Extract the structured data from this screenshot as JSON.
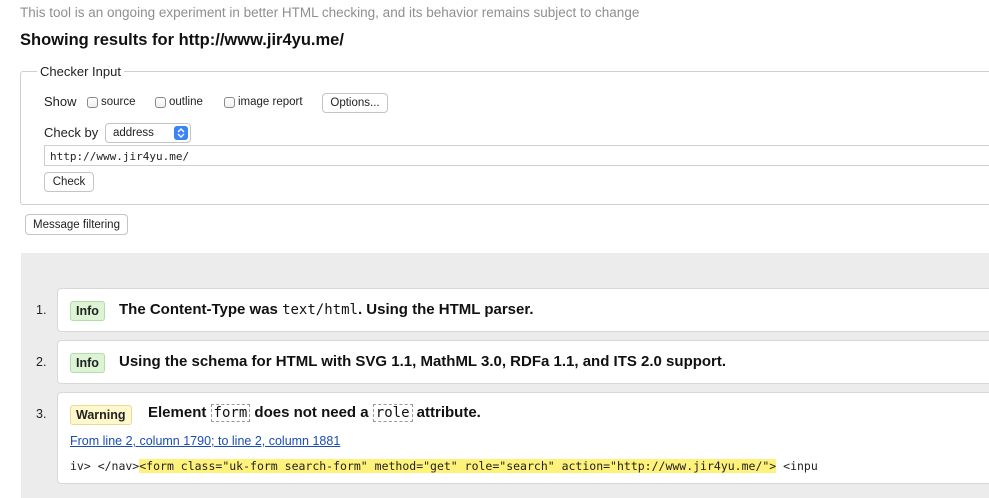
{
  "notice": "This tool is an ongoing experiment in better HTML checking, and its behavior remains subject to change",
  "heading": "Showing results for http://www.jir4yu.me/",
  "checker": {
    "legend": "Checker Input",
    "show_label": "Show",
    "options": [
      {
        "label": "source",
        "checked": false
      },
      {
        "label": "outline",
        "checked": false
      },
      {
        "label": "image report",
        "checked": false
      }
    ],
    "options_button": "Options...",
    "check_by_label": "Check by",
    "check_by_value": "address",
    "url_value": "http://www.jir4yu.me/",
    "check_button": "Check"
  },
  "message_filtering_button": "Message filtering",
  "messages": [
    {
      "number": "1.",
      "type": "Info",
      "text_before": "The Content-Type was ",
      "code": "text/html",
      "text_after": ". Using the HTML parser."
    },
    {
      "number": "2.",
      "type": "Info",
      "text": "Using the schema for HTML with SVG 1.1, MathML 3.0, RDFa 1.1, and ITS 2.0 support."
    },
    {
      "number": "3.",
      "type": "Warning",
      "text_1": "Element ",
      "code_1": "form",
      "text_2": " does not need a ",
      "code_2": "role",
      "text_3": " attribute.",
      "location": "From line 2, column 1790; to line 2, column 1881",
      "extract_before": "iv> </nav>",
      "extract_highlight": "<form class=\"uk-form search-form\" method=\"get\" role=\"search\" action=\"http://www.jir4yu.me/\">",
      "extract_after": " <inpu"
    }
  ],
  "colors": {
    "info_badge": "#dcf3d6",
    "warning_badge": "#fff8cc",
    "highlight": "#fff27a",
    "link": "#1a4db8",
    "select_arrow": "#3b84f5"
  }
}
